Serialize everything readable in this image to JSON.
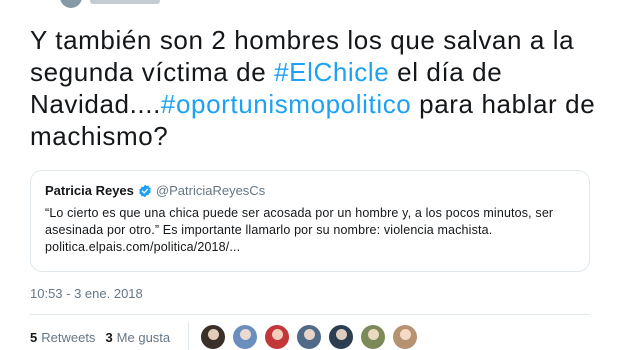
{
  "tweet": {
    "text_1": "Y también son 2 hombres los que salvan a la segunda víctima de ",
    "hashtag_1": "#ElChicle",
    "text_2": " el día de Navidad....",
    "hashtag_2": "#oportunismopolitico",
    "text_3": " para hablar de machismo?"
  },
  "quote": {
    "name": "Patricia Reyes",
    "handle": "@PatriciaReyesCs",
    "body": "“Lo cierto es que una chica puede ser acosada por un hombre y, a los pocos minutos, ser asesinada por otro.” Es importante llamarlo por su nombre: violencia machista.",
    "link": "politica.elpais.com/politica/2018/..."
  },
  "timestamp": "10:53 - 3 ene. 2018",
  "stats": {
    "retweets_count": "5",
    "retweets_label": "Retweets",
    "likes_count": "3",
    "likes_label": "Me gusta"
  },
  "icons": {
    "verified": "verified-badge-icon"
  },
  "colors": {
    "hashtag": "#1da1f2",
    "muted": "#657786",
    "border": "#e1e8ed",
    "verified": "#1da1f2"
  },
  "avatars": [
    {
      "name": "avatar-1",
      "bg": "#3b2f2a"
    },
    {
      "name": "avatar-2",
      "bg": "#6a8fbf"
    },
    {
      "name": "avatar-3",
      "bg": "#c2373a"
    },
    {
      "name": "avatar-4",
      "bg": "#4f6b87"
    },
    {
      "name": "avatar-5",
      "bg": "#2c3f52"
    },
    {
      "name": "avatar-6",
      "bg": "#7c8a5a"
    },
    {
      "name": "avatar-7",
      "bg": "#b79272"
    }
  ]
}
